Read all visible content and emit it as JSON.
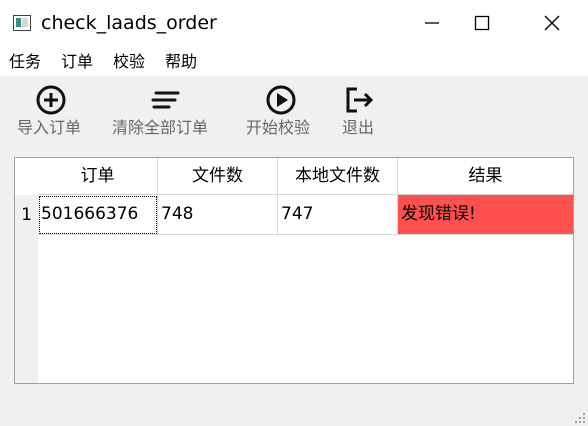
{
  "window": {
    "title": "check_laads_order"
  },
  "menubar": {
    "items": [
      "任务",
      "订单",
      "校验",
      "帮助"
    ]
  },
  "toolbar": {
    "buttons": [
      {
        "label": "导入订单",
        "icon": "plus-circle-icon"
      },
      {
        "label": "清除全部订单",
        "icon": "clear-lines-icon"
      },
      {
        "label": "开始校验",
        "icon": "play-circle-icon"
      },
      {
        "label": "退出",
        "icon": "exit-icon"
      }
    ]
  },
  "table": {
    "columns": [
      "订单",
      "文件数",
      "本地文件数",
      "结果"
    ],
    "rows": [
      {
        "index": "1",
        "cells": [
          "501666376",
          "748",
          "747",
          "发现错误!"
        ],
        "result_color": "#ff5050"
      }
    ]
  },
  "colors": {
    "error_cell": "#ff5050",
    "toolbar_label": "#666666"
  }
}
